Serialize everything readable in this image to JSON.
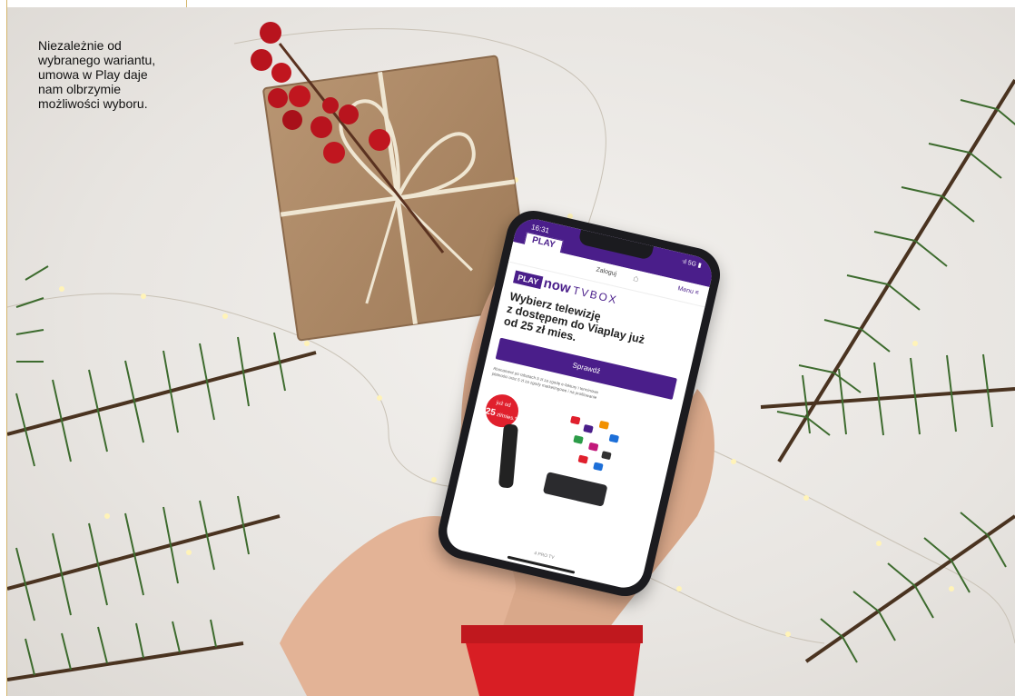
{
  "caption": {
    "lines": [
      "Niezależnie od",
      "wybranego wariantu,",
      "umowa w Play daje",
      "nam olbrzymie",
      "możliwości wyboru."
    ]
  },
  "phone": {
    "status_time": "16:31",
    "status_icons": "ᐧıl 5G ▮",
    "logo": "PLAY",
    "nav_login": "Zaloguj",
    "nav_menu": "Menu ≡",
    "brand_play": "PLAY",
    "brand_now": "now",
    "brand_tvbox": "TVBOX",
    "headline": [
      "Wybierz telewizję",
      "z dostępem do Viaplay już",
      "od 25 zł mies."
    ],
    "cta_label": "Sprawdź",
    "fineprint": [
      "Abonament po rabatach 5 zł za zgodę e-faktury i terminowe",
      "płatności oraz 5 zł za zgody marketingowe i na profilowanie"
    ],
    "badge_top": "już od",
    "badge_value": "25",
    "badge_unit": "zł/mies.*",
    "bottom_text": "4 PRO TV"
  },
  "colors": {
    "play_purple": "#4a1e8a",
    "badge_red": "#e0202d",
    "frame_gold": "#d4b56a"
  }
}
